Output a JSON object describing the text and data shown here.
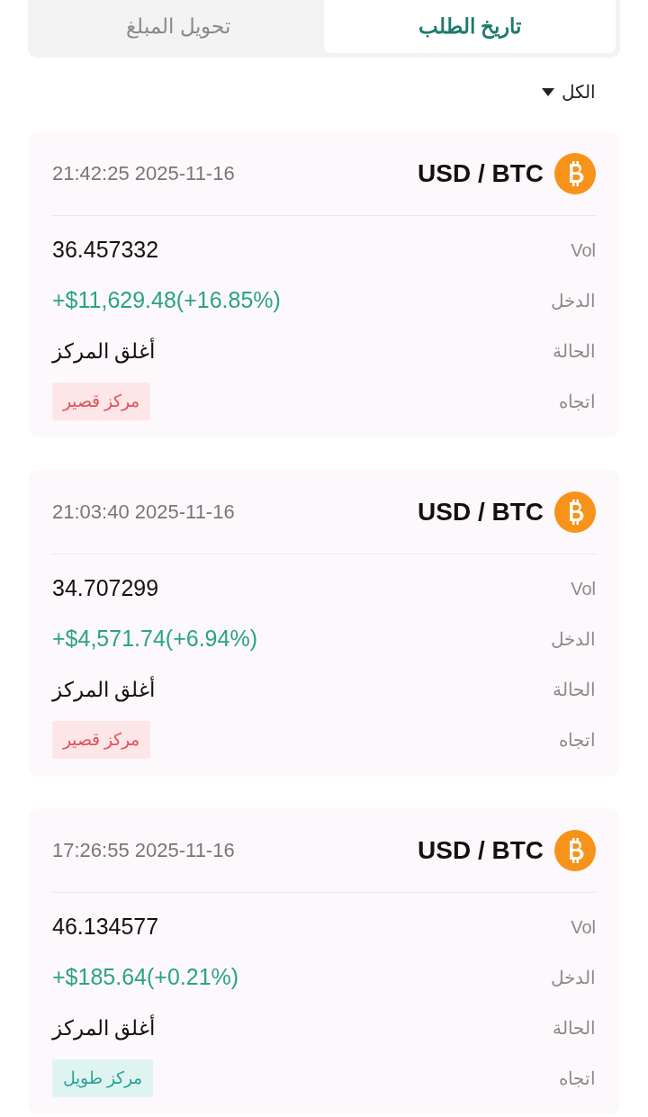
{
  "tabs": [
    {
      "label": "تاريخ الطلب",
      "selected": true
    },
    {
      "label": "تحويل المبلغ",
      "selected": false
    }
  ],
  "filter": {
    "label": "الكل"
  },
  "orders": [
    {
      "pair": "USD / BTC",
      "datetime": "2025-11-16 21:42:25",
      "vol_label": "Vol",
      "vol": "36.457332",
      "income_label": "الدخل",
      "income": "+$11,629.48(+16.85%)",
      "status_label": "الحالة",
      "status": "أغلق المركز",
      "direction_label": "اتجاه",
      "direction": {
        "label": "مركز قصير",
        "kind": "short"
      }
    },
    {
      "pair": "USD / BTC",
      "datetime": "2025-11-16 21:03:40",
      "vol_label": "Vol",
      "vol": "34.707299",
      "income_label": "الدخل",
      "income": "+$4,571.74(+6.94%)",
      "status_label": "الحالة",
      "status": "أغلق المركز",
      "direction_label": "اتجاه",
      "direction": {
        "label": "مركز قصير",
        "kind": "short"
      }
    },
    {
      "pair": "USD / BTC",
      "datetime": "2025-11-16 17:26:55",
      "vol_label": "Vol",
      "vol": "46.134577",
      "income_label": "الدخل",
      "income": "+$185.64(+0.21%)",
      "status_label": "الحالة",
      "status": "أغلق المركز",
      "direction_label": "اتجاه",
      "direction": {
        "label": "مركز طويل",
        "kind": "long"
      }
    }
  ]
}
